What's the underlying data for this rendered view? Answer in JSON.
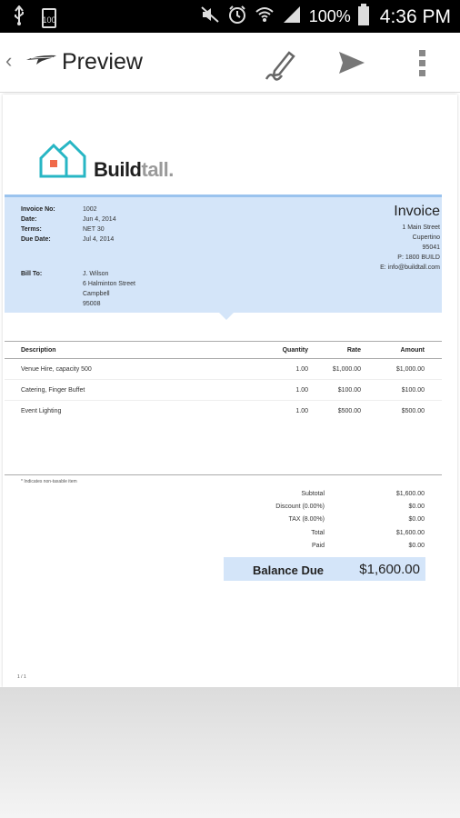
{
  "status_bar": {
    "battery_small_label": "100",
    "battery_percent": "100%",
    "time": "4:36 PM"
  },
  "action_bar": {
    "back_glyph": "‹",
    "title": "Preview",
    "icons": [
      "app-logo-icon",
      "signature-pen-icon",
      "send-icon",
      "overflow-menu-icon"
    ]
  },
  "invoice": {
    "brand_part1": "Build",
    "brand_part2": "tall.",
    "heading": "Invoice",
    "meta": [
      {
        "label": "Invoice No:",
        "value": "1002"
      },
      {
        "label": "Date:",
        "value": "Jun 4, 2014"
      },
      {
        "label": "Terms:",
        "value": "NET 30"
      },
      {
        "label": "Due Date:",
        "value": "Jul 4, 2014"
      }
    ],
    "bill_to_label": "Bill To:",
    "bill_to": [
      "J. Wilson",
      "6 Halminton Street",
      "Campbell",
      "95008"
    ],
    "company_address": [
      "1 Main Street",
      "Cupertino",
      "95041",
      "P: 1800 BUILD",
      "E: info@buildtall.com"
    ],
    "columns": [
      "Description",
      "Quantity",
      "Rate",
      "Amount"
    ],
    "items": [
      {
        "description": "Venue Hire, capacity 500",
        "quantity": "1.00",
        "rate": "$1,000.00",
        "amount": "$1,000.00"
      },
      {
        "description": "Catering, Finger Buffet",
        "quantity": "1.00",
        "rate": "$100.00",
        "amount": "$100.00"
      },
      {
        "description": "Event Lighting",
        "quantity": "1.00",
        "rate": "$500.00",
        "amount": "$500.00"
      }
    ],
    "note": "* Indicates non-taxable item",
    "totals": [
      {
        "label": "Subtotal",
        "value": "$1,600.00"
      },
      {
        "label": "Discount (0.00%)",
        "value": "$0.00"
      },
      {
        "label": "TAX (8.00%)",
        "value": "$0.00"
      },
      {
        "label": "Total",
        "value": "$1,600.00"
      },
      {
        "label": "Paid",
        "value": "$0.00"
      }
    ],
    "balance_label": "Balance Due",
    "balance_value": "$1,600.00",
    "page_number": "1 / 1"
  },
  "colors": {
    "accent_band": "#d4e5f9",
    "logo_teal": "#27b6c4",
    "logo_orange": "#f06a4a"
  }
}
